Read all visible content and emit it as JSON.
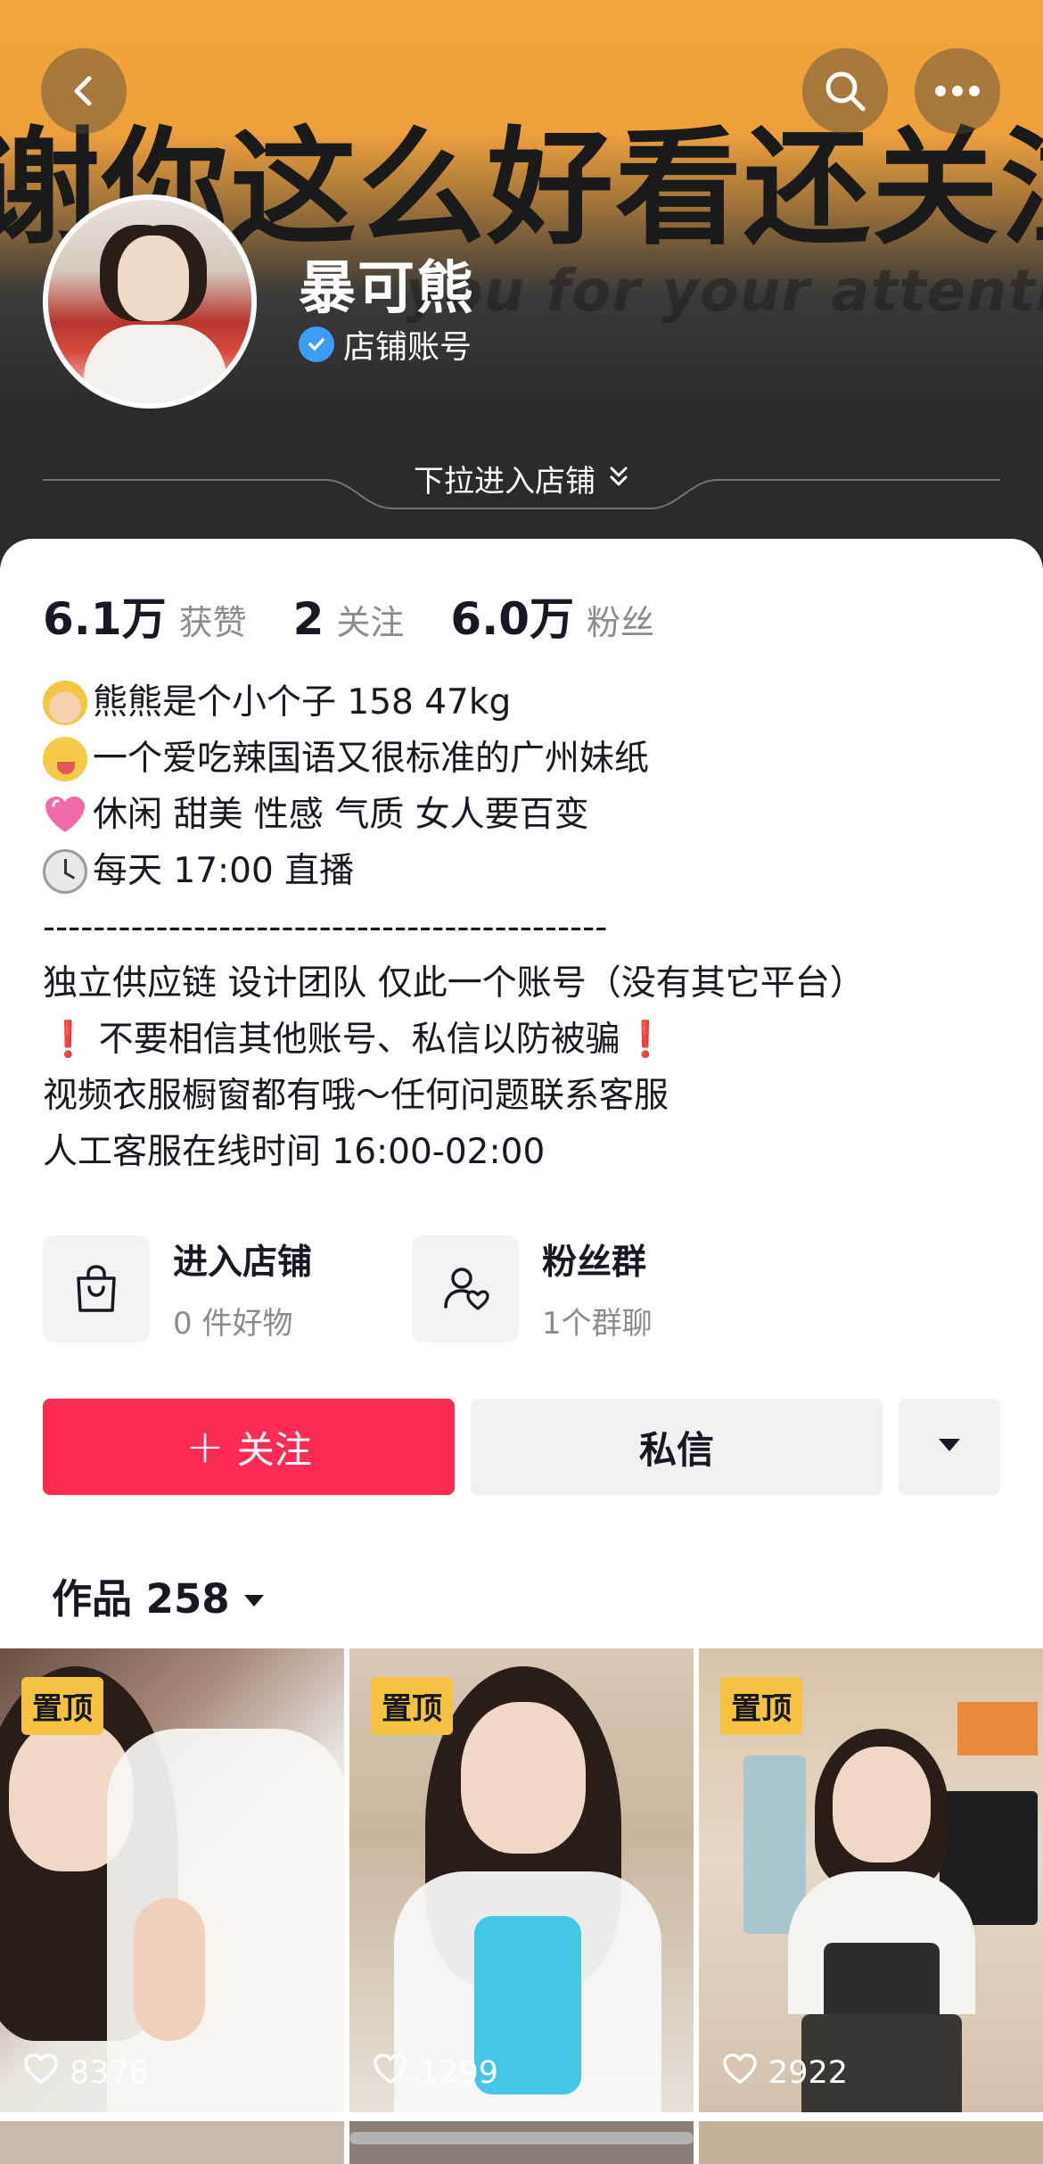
{
  "header": {
    "banner_text": "谢你这么好看还关注",
    "banner_subtext": "you for your attention",
    "back_icon": "chevron-left-icon",
    "search_icon": "search-icon",
    "more_icon": "more-dots-icon",
    "pull_hint": "下拉进入店铺"
  },
  "profile": {
    "name": "暴可熊",
    "account_type": "店铺账号"
  },
  "stats": [
    {
      "value": "6.1万",
      "label": "获赞"
    },
    {
      "value": "2",
      "label": "关注"
    },
    {
      "value": "6.0万",
      "label": "粉丝"
    }
  ],
  "bio": {
    "line1": "熊熊是个小个子  158 47kg",
    "line2": "一个爱吃辣国语又很标准的广州妹纸",
    "line3": "休闲 甜美 性感 气质 女人要百变",
    "line4": "每天 17:00 直播",
    "divider": "---------------------------------------------",
    "line5": "独立供应链 设计团队 仅此一个账号（没有其它平台）",
    "line6_mark": "❗",
    "line6": "不要相信其他账号、私信以防被骗",
    "line7": "视频衣服橱窗都有哦～任何问题联系客服",
    "line8": "人工客服在线时间 16:00-02:00"
  },
  "entries": {
    "shop": {
      "title": "进入店铺",
      "subtitle": "0 件好物"
    },
    "fans": {
      "title": "粉丝群",
      "subtitle": "1个群聊"
    }
  },
  "actions": {
    "follow_plus": "+",
    "follow": "关注",
    "message": "私信"
  },
  "works": {
    "label": "作品 258",
    "items": [
      {
        "pinned": "置顶",
        "likes": "8376"
      },
      {
        "pinned": "置顶",
        "likes": "1299"
      },
      {
        "pinned": "置顶",
        "likes": "2922"
      }
    ]
  },
  "colors": {
    "accent": "#fe2c55",
    "pin_badge": "#f5c242",
    "verified": "#3d9cf5"
  }
}
